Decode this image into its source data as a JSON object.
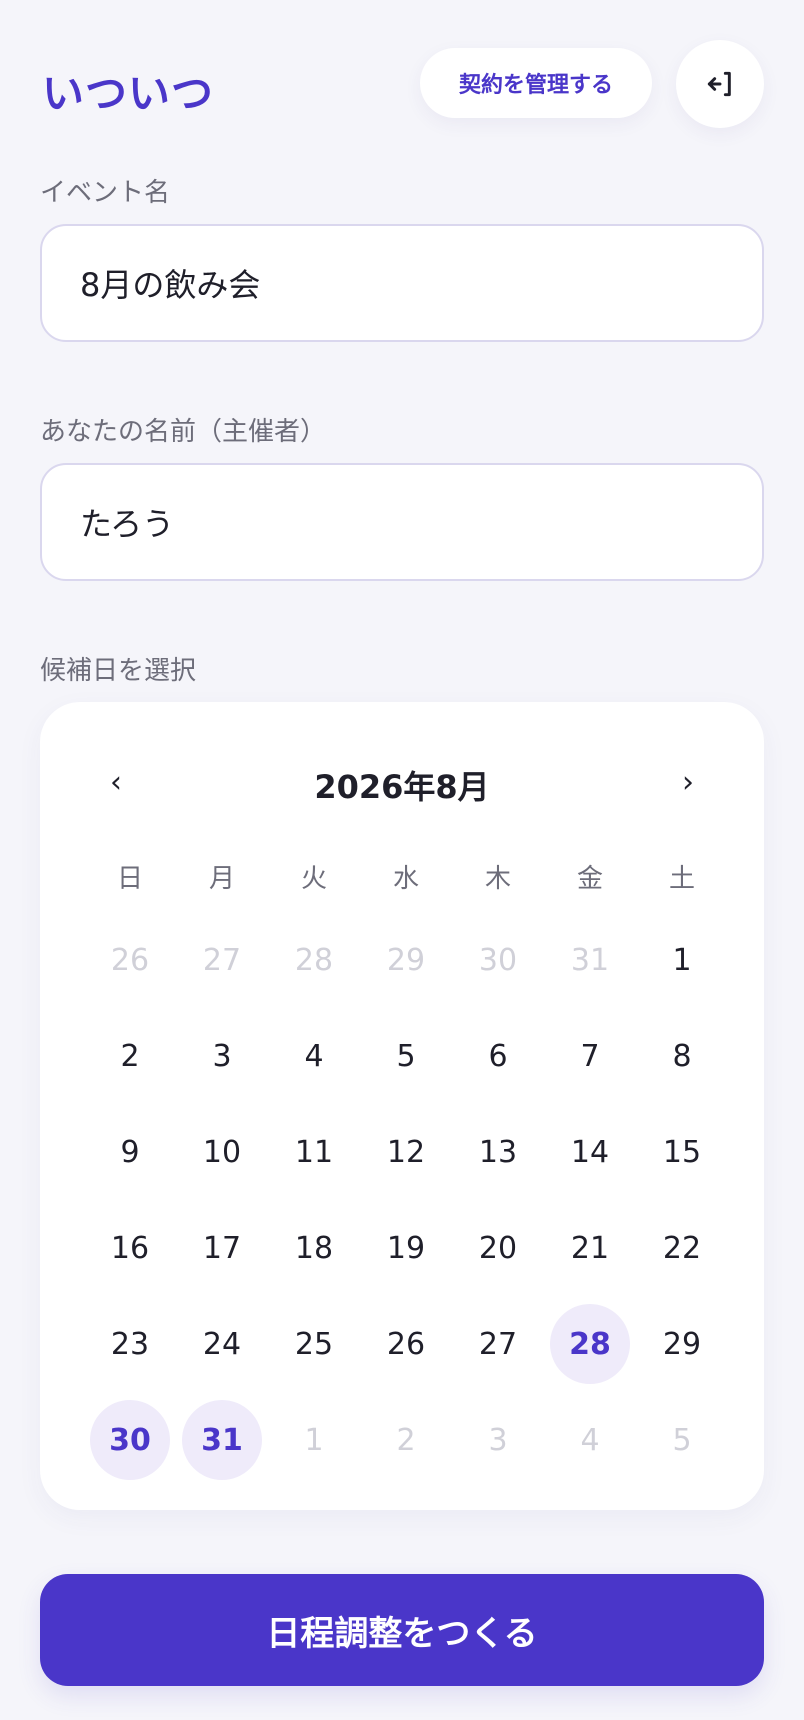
{
  "header": {
    "brand": "いついつ",
    "manage_label": "契約を管理する",
    "logout_icon": "logout-icon"
  },
  "form": {
    "event_name_label": "イベント名",
    "event_name_value": "8月の飲み会",
    "host_name_label": "あなたの名前（主催者）",
    "host_name_value": "たろう",
    "date_select_label": "候補日を選択"
  },
  "calendar": {
    "month_title": "2026年8月",
    "prev_label": "‹",
    "next_label": "›",
    "weekdays": [
      "日",
      "月",
      "火",
      "水",
      "木",
      "金",
      "土"
    ],
    "days": [
      {
        "label": "26",
        "in_month": false,
        "selected": false
      },
      {
        "label": "27",
        "in_month": false,
        "selected": false
      },
      {
        "label": "28",
        "in_month": false,
        "selected": false
      },
      {
        "label": "29",
        "in_month": false,
        "selected": false
      },
      {
        "label": "30",
        "in_month": false,
        "selected": false
      },
      {
        "label": "31",
        "in_month": false,
        "selected": false
      },
      {
        "label": "1",
        "in_month": true,
        "selected": false
      },
      {
        "label": "2",
        "in_month": true,
        "selected": false
      },
      {
        "label": "3",
        "in_month": true,
        "selected": false
      },
      {
        "label": "4",
        "in_month": true,
        "selected": false
      },
      {
        "label": "5",
        "in_month": true,
        "selected": false
      },
      {
        "label": "6",
        "in_month": true,
        "selected": false
      },
      {
        "label": "7",
        "in_month": true,
        "selected": false
      },
      {
        "label": "8",
        "in_month": true,
        "selected": false
      },
      {
        "label": "9",
        "in_month": true,
        "selected": false
      },
      {
        "label": "10",
        "in_month": true,
        "selected": false
      },
      {
        "label": "11",
        "in_month": true,
        "selected": false
      },
      {
        "label": "12",
        "in_month": true,
        "selected": false
      },
      {
        "label": "13",
        "in_month": true,
        "selected": false
      },
      {
        "label": "14",
        "in_month": true,
        "selected": false
      },
      {
        "label": "15",
        "in_month": true,
        "selected": false
      },
      {
        "label": "16",
        "in_month": true,
        "selected": false
      },
      {
        "label": "17",
        "in_month": true,
        "selected": false
      },
      {
        "label": "18",
        "in_month": true,
        "selected": false
      },
      {
        "label": "19",
        "in_month": true,
        "selected": false
      },
      {
        "label": "20",
        "in_month": true,
        "selected": false
      },
      {
        "label": "21",
        "in_month": true,
        "selected": false
      },
      {
        "label": "22",
        "in_month": true,
        "selected": false
      },
      {
        "label": "23",
        "in_month": true,
        "selected": false
      },
      {
        "label": "24",
        "in_month": true,
        "selected": false
      },
      {
        "label": "25",
        "in_month": true,
        "selected": false
      },
      {
        "label": "26",
        "in_month": true,
        "selected": false
      },
      {
        "label": "27",
        "in_month": true,
        "selected": false
      },
      {
        "label": "28",
        "in_month": true,
        "selected": true
      },
      {
        "label": "29",
        "in_month": true,
        "selected": false
      },
      {
        "label": "30",
        "in_month": true,
        "selected": true
      },
      {
        "label": "31",
        "in_month": true,
        "selected": true
      },
      {
        "label": "1",
        "in_month": false,
        "selected": false
      },
      {
        "label": "2",
        "in_month": false,
        "selected": false
      },
      {
        "label": "3",
        "in_month": false,
        "selected": false
      },
      {
        "label": "4",
        "in_month": false,
        "selected": false
      },
      {
        "label": "5",
        "in_month": false,
        "selected": false
      }
    ]
  },
  "actions": {
    "submit_label": "日程調整をつくる"
  },
  "colors": {
    "accent": "#4a36c9",
    "accent_soft": "#efebfa",
    "muted_text": "#6d6d7a",
    "disabled_text": "#d0d0d8",
    "background": "#f5f5fa"
  }
}
